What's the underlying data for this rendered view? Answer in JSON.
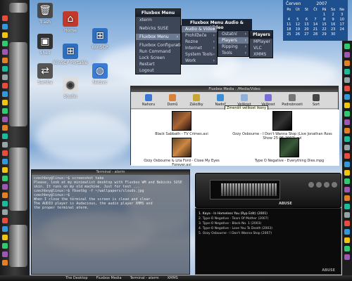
{
  "desktop_icons": [
    {
      "label": "Trash",
      "icon": "trash-icon",
      "color": "#4a4a4a"
    },
    {
      "label": "Home",
      "icon": "home-icon",
      "color": "#c0392b"
    },
    {
      "label": "Shell",
      "icon": "terminal-icon",
      "color": "#333333"
    },
    {
      "label": "WinSCP",
      "icon": "windows-icon",
      "color": "#2e6fbf"
    },
    {
      "label": "Samba",
      "icon": "network-icon",
      "color": "#555555"
    },
    {
      "label": "WinSCP Portable",
      "icon": "windows-icon",
      "color": "#2e6fbf"
    },
    {
      "label": "Netsvc",
      "icon": "globe-icon",
      "color": "#3a7bd5"
    },
    {
      "label": "Diskwatch",
      "icon": "disk-icon",
      "color": "#dddddd"
    },
    {
      "label": "Studio",
      "icon": "cd-icon",
      "color": "#cccccc"
    }
  ],
  "fluxbox_menu": {
    "title": "Fluxbox Menu",
    "items": [
      "xterm",
      "",
      "Nebicks SUSE",
      "",
      "Fluxbox Menu",
      "",
      "Fluxbox Configuration",
      "Run Command",
      "Lock Screen",
      "Restart",
      "Logout"
    ]
  },
  "submenu_av": {
    "title": "Fluxbox Menu Audio & Video",
    "items": [
      "Audio & Video",
      "Prohlížeče",
      "Rozne",
      "Internet",
      "System Tools",
      "Work"
    ]
  },
  "submenu_av2": {
    "items": [
      "Ostatní",
      "Players",
      "Ripping",
      "Tools"
    ]
  },
  "submenu_players": {
    "title": "Players",
    "items": [
      "MPlayer",
      "VLC",
      "XMMS"
    ]
  },
  "calendar": {
    "month": "Červen",
    "year": "2007",
    "weekdays": [
      "Po",
      "Út",
      "St",
      "Čt",
      "Pá",
      "So",
      "Ne"
    ],
    "days": [
      "",
      "",
      "",
      "",
      "1",
      "2",
      "3",
      "4",
      "5",
      "6",
      "7",
      "8",
      "9",
      "10",
      "11",
      "12",
      "13",
      "14",
      "15",
      "16",
      "17",
      "18",
      "19",
      "20",
      "21",
      "22",
      "23",
      "24",
      "25",
      "26",
      "27",
      "28",
      "29",
      "30",
      ""
    ]
  },
  "file_manager": {
    "title": "Fluxbox Media : /Media/Video",
    "toolbar": [
      {
        "label": "Nahoru",
        "color": "#3a78d8"
      },
      {
        "label": "Domů",
        "color": "#d8823a"
      },
      {
        "label": "Záložky",
        "color": "#c9a532"
      },
      {
        "label": "Nadoř",
        "color": "#3a8fd8"
      },
      {
        "label": "Velikost",
        "color": "#8fb1da"
      },
      {
        "label": "Velikost",
        "color": "#7a6fd8"
      },
      {
        "label": "Podrobnosti",
        "color": "#777777"
      },
      {
        "label": "Sort",
        "color": "#444444"
      }
    ],
    "tooltip": "Zmenšit velikost ikony",
    "files": [
      "Black Sabbath - TV Crimes.avi",
      "Ozzy Osbourne - I Don't Wanna Stop (Live Jonathan Ross Show 25-05-2007).avi",
      "Ozzy Osbourne & Lita Ford - Close My Eyes Forever.avi",
      "Type O Negative - Everything Dies.mpg"
    ]
  },
  "terminal": {
    "title": "Terminal - aterm",
    "lines": [
      "czechboy@linux:~$ screenshot take",
      "Please, look at my minimalist desktop with Fluxbox WM and Nebicks SUSE",
      "skin. It runs on my old machine. Just for test ...",
      "czechboy@linux:~$ fbsetbg -f ~/wallpapers/clouds.jpg",
      "czechboy@linux:~$ _",
      "When I close the terminal the screen is clean and clear.",
      "The AUDIO player is Audacious, the audio player XMMS and",
      "the proper terminal aterm."
    ]
  },
  "player": {
    "brand": "ABUSE"
  },
  "playlist": {
    "rows": [
      "1. Kaya - In Homeless You (Ryp Edit) (2001)",
      "2. Type-O Negative - Tears Of Mother (2007)",
      "3. Type-O Negative - Black No. 1 (2003)",
      "4. Type-O Negative - Love You To Death (2003)",
      "5. Ozzy Osbourne - I Don't Wanna Stop (2007)"
    ],
    "brand": "ABUSE"
  },
  "taskbar": {
    "tasks": [
      "The Desktop",
      "Fluxbox Media",
      "Terminal - aterm",
      "XMMS"
    ]
  }
}
